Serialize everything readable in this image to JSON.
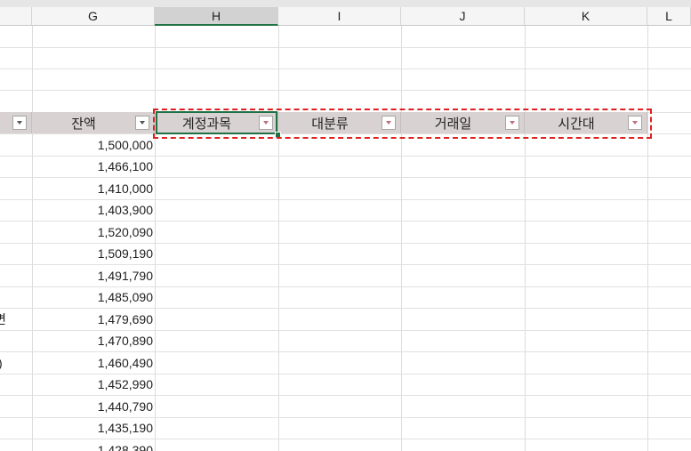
{
  "columns": [
    "G",
    "H",
    "I",
    "J",
    "K",
    "L"
  ],
  "active_column": "H",
  "headers": {
    "balance": "잔액",
    "account": "계정과목",
    "category": "대분류",
    "date": "거래일",
    "time_slot": "시간대"
  },
  "balances": [
    "1,500,000",
    "1,466,100",
    "1,410,000",
    "1,403,900",
    "1,520,090",
    "1,509,190",
    "1,491,790",
    "1,485,090",
    "1,479,690",
    "1,470,890",
    "1,460,490",
    "1,452,990",
    "1,440,790",
    "1,435,190",
    "1,428,390"
  ],
  "partial_left": {
    "r8": "변",
    "r10": ")"
  },
  "colors": {
    "header_fill": "#d9d2d2",
    "selection": "#1e7145",
    "highlight_dash": "#e02020"
  }
}
